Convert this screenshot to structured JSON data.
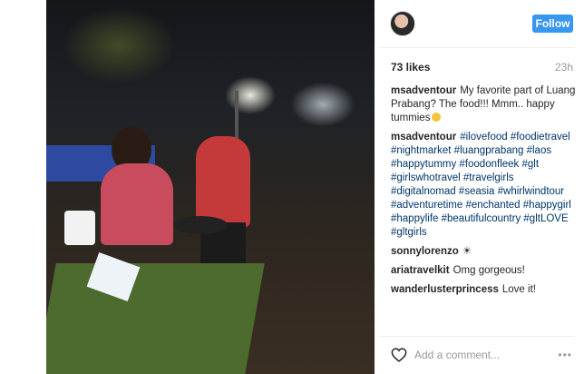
{
  "post": {
    "image_alt": "",
    "follow_label": "Follow",
    "likes": "73 likes",
    "time_ago": "23h"
  },
  "comments": [
    {
      "user": "msadventour",
      "text": "My favorite part of Luang Prabang? The food!!! Mmm.. happy tummies",
      "emoji": "smile-emoji"
    },
    {
      "user": "msadventour",
      "text": "#ilovefood #foodietravel #nightmarket #luangprabang #laos #happytummy #foodonfleek #glt #girlswhotravel #travelgirls #digitalnomad #seasia #whirlwindtour #adventuretime #enchanted #happygirl #happylife #beautifulcountry #gltLOVE #gltgirls"
    },
    {
      "user": "sonnylorenzo",
      "text": "☀"
    },
    {
      "user": "ariatravelkit",
      "text": "Omg gorgeous!"
    },
    {
      "user": "wanderlusterprincess",
      "text": "Love it!"
    }
  ],
  "add_comment": {
    "placeholder": "Add a comment...",
    "more": "•••"
  },
  "colors": {
    "accent": "#3897f0",
    "muted": "#999999",
    "text": "#262626"
  },
  "icons": [
    "heart-icon",
    "more-options-icon"
  ]
}
